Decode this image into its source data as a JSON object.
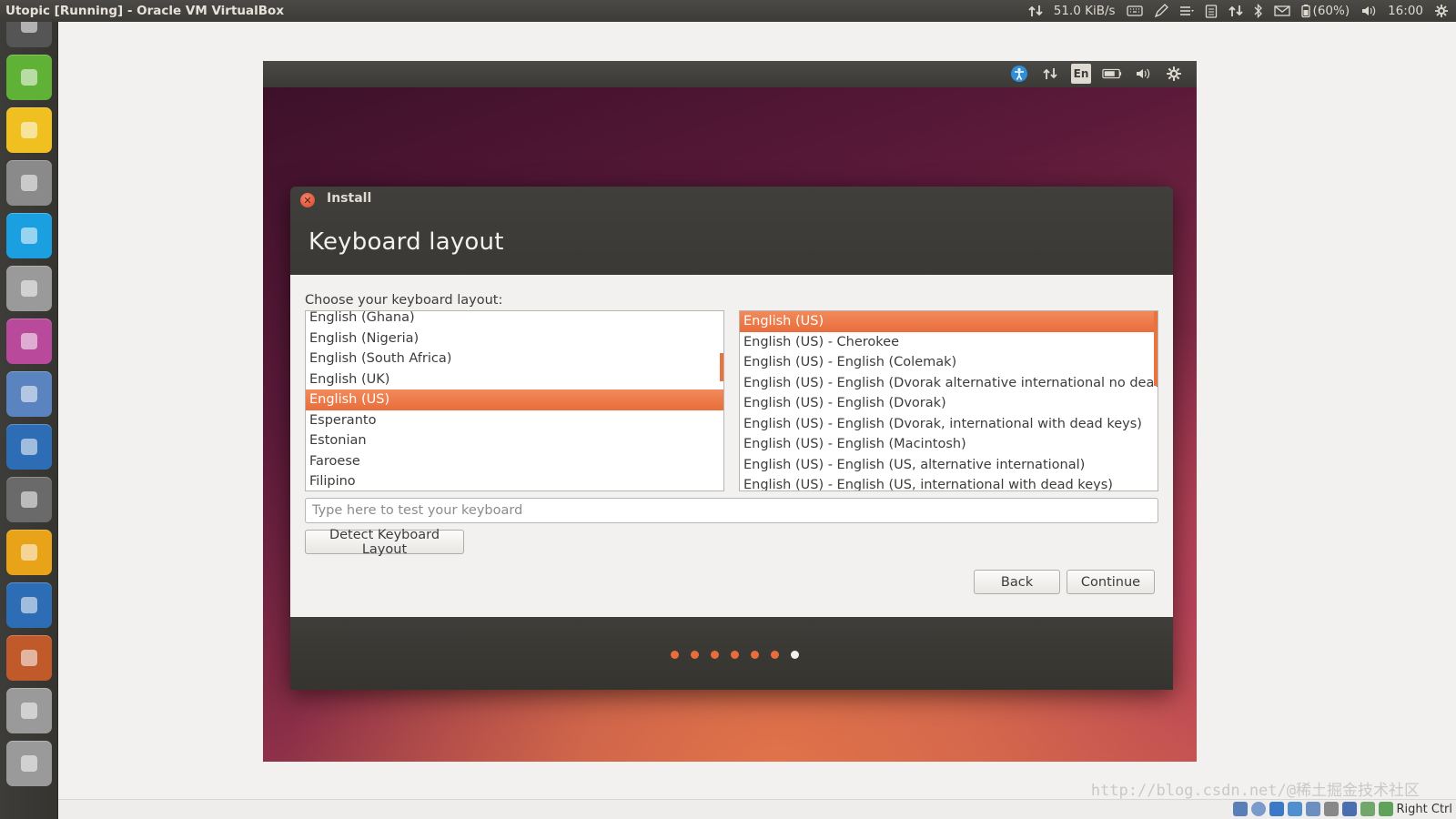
{
  "host": {
    "window_title": "Utopic [Running] - Oracle VM VirtualBox",
    "network_speed": "51.0 KiB/s",
    "battery": "(60%)",
    "clock": "16:00",
    "indicator_icons": [
      "network-transfer-icon",
      "keyboard-icon",
      "pen-icon",
      "menu-icon",
      "clipboard-icon",
      "network-icon",
      "bluetooth-icon",
      "mail-icon",
      "battery-icon",
      "volume-icon",
      "gear-icon"
    ]
  },
  "launcher": {
    "items": [
      {
        "name": "dash-icon",
        "color": "#555"
      },
      {
        "name": "note-edit-icon",
        "color": "#5fb235"
      },
      {
        "name": "teapot-icon",
        "color": "#f0c020"
      },
      {
        "name": "image-viewer-icon",
        "color": "#8a8a8a"
      },
      {
        "name": "skype-icon",
        "color": "#1aa0e0"
      },
      {
        "name": "text-editor-icon",
        "color": "#9a9a9a"
      },
      {
        "name": "pink-window-icon",
        "color": "#b94a9b"
      },
      {
        "name": "color-wheel-icon",
        "color": "#5a84bf"
      },
      {
        "name": "screenshot-icon",
        "color": "#2d6db5"
      },
      {
        "name": "paint-brush-icon",
        "color": "#6a6a6a"
      },
      {
        "name": "cd-burner-icon",
        "color": "#e8a318"
      },
      {
        "name": "document-icon",
        "color": "#2d6db5"
      },
      {
        "name": "presentation-icon",
        "color": "#c05a2a"
      },
      {
        "name": "hard-drive-icon",
        "color": "#9a9a9a"
      },
      {
        "name": "hard-drive-2-icon",
        "color": "#9a9a9a"
      }
    ]
  },
  "vm": {
    "indicators": [
      {
        "name": "accessibility-icon",
        "label": ""
      },
      {
        "name": "network-transfer-icon",
        "label": ""
      },
      {
        "name": "keyboard-language-indicator",
        "label": "En"
      },
      {
        "name": "battery-icon",
        "label": ""
      },
      {
        "name": "volume-icon",
        "label": ""
      },
      {
        "name": "gear-icon",
        "label": ""
      }
    ]
  },
  "installer": {
    "window_title": "Install",
    "heading": "Keyboard layout",
    "prompt": "Choose your keyboard layout:",
    "layouts": [
      {
        "label": "English (Ghana)",
        "selected": false
      },
      {
        "label": "English (Nigeria)",
        "selected": false
      },
      {
        "label": "English (South Africa)",
        "selected": false
      },
      {
        "label": "English (UK)",
        "selected": false
      },
      {
        "label": "English (US)",
        "selected": true
      },
      {
        "label": "Esperanto",
        "selected": false
      },
      {
        "label": "Estonian",
        "selected": false
      },
      {
        "label": "Faroese",
        "selected": false
      },
      {
        "label": "Filipino",
        "selected": false
      }
    ],
    "variants": [
      {
        "label": "English (US)",
        "selected": true
      },
      {
        "label": "English (US) - Cherokee",
        "selected": false
      },
      {
        "label": "English (US) - English (Colemak)",
        "selected": false
      },
      {
        "label": "English (US) - English (Dvorak alternative international no dead keys)",
        "selected": false
      },
      {
        "label": "English (US) - English (Dvorak)",
        "selected": false
      },
      {
        "label": "English (US) - English (Dvorak, international with dead keys)",
        "selected": false
      },
      {
        "label": "English (US) - English (Macintosh)",
        "selected": false
      },
      {
        "label": "English (US) - English (US, alternative international)",
        "selected": false
      },
      {
        "label": "English (US) - English (US, international with dead keys)",
        "selected": false
      }
    ],
    "test_placeholder": "Type here to test your keyboard",
    "test_value": "",
    "detect_button": "Detect Keyboard Layout",
    "back_button": "Back",
    "continue_button": "Continue",
    "progress": {
      "completed_steps": 6,
      "total_steps": 7
    },
    "accent_color": "#e96d3c"
  },
  "statusbar": {
    "host_key": "Right Ctrl",
    "watermark": "http://blog.csdn.net/@稀土掘金技术社区"
  }
}
